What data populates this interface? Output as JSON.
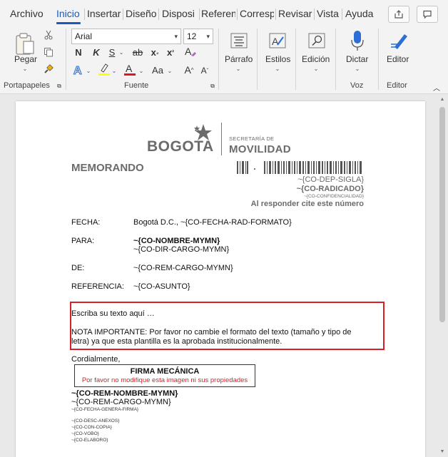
{
  "tabs": [
    "Archivo",
    "Inicio",
    "Insertar",
    "Diseño",
    "Disposi",
    "Referen",
    "Corresp",
    "Revisar",
    "Vista",
    "Ayuda"
  ],
  "ribbon": {
    "portapapeles": {
      "pegar_label": "Pegar",
      "group_label": "Portapapeles"
    },
    "fuente": {
      "font_name": "Arial",
      "font_size": "12",
      "bold": "N",
      "italic": "K",
      "underline": "S",
      "strike": "ab",
      "subscript": "x",
      "superscript": "x",
      "aa": "Aa",
      "grow": "A",
      "shrink": "A",
      "group_label": "Fuente",
      "highlight_color": "#ffff00",
      "font_color": "#e81123"
    },
    "parrafo_label": "Párrafo",
    "estilos_label": "Estilos",
    "edicion_label": "Edición",
    "dictar_label": "Dictar",
    "voz_group": "Voz",
    "editor_label": "Editor",
    "editor_group": "Editor"
  },
  "document": {
    "logo": {
      "bogota": "BOGOT",
      "bogota_last": "A",
      "secretaria": "SECRETARÍA DE",
      "movilidad": "MOVILIDAD"
    },
    "title": "MEMORANDO",
    "dep_sigla": "~{CO-DEP-SIGLA}",
    "radicado": "~{CO-RADICADO}",
    "confidencialidad": "~{CO-CONFIDENCIALIDAD}",
    "responder": "Al responder cite este número",
    "fields": [
      {
        "label": "FECHA:",
        "value": "Bogotá D.C., ~{CO-FECHA-RAD-FORMATO}"
      },
      {
        "label": "PARA:",
        "value": "~{CO-NOMBRE-MYMN}",
        "value2": "~{CO-DIR-CARGO-MYMN}"
      },
      {
        "label": "DE:",
        "value": "~{CO-REM-CARGO-MYMN}"
      },
      {
        "label": "REFERENCIA:",
        "value": "~{CO-ASUNTO}"
      }
    ],
    "body_text": "Escriba su texto aquí …",
    "nota_line1": "NOTA IMPORTANTE: Por favor no cambie el formato del texto (tamaño y tipo de",
    "nota_line2": "letra) ya que esta plantilla es la aprobada institucionalmente.",
    "cordialmente": "Cordialmente,",
    "firma_title": "FIRMA MECÁNICA",
    "firma_sub": "Por favor no modifique esta imagen ni sus propiedades",
    "rem_nombre": "~{CO-REM-NOMBRE-MYMN}",
    "rem_cargo": "~{CO-REM-CARGO-MYMN}",
    "fecha_firma": "~{CO-FECHA-GENERA-FIRMA}",
    "anexos": "~{CO-DESC-ANEXOS}",
    "copia": "~{CO-CON-COPIA}",
    "vobo": "~{CO-VOBO}",
    "elaboro": "~{CO-ELABORO}"
  }
}
